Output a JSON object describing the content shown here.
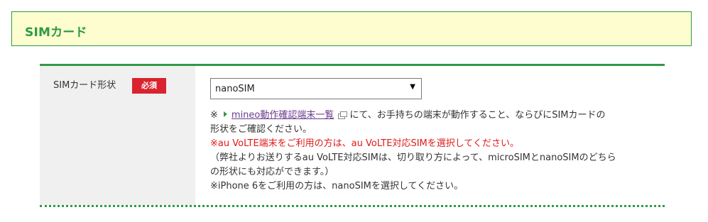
{
  "section": {
    "title": "SIMカード"
  },
  "field": {
    "label": "SIMカード形状",
    "required_badge": "必須",
    "selected_value": "nanoSIM",
    "dropdown_arrow": "▼"
  },
  "notes": {
    "prefix": "※",
    "link_text": "mineo動作確認端末一覧",
    "after_link_line1": "にて、お手持ちの端末が動作すること、ならびにSIMカードの",
    "line2": "形状をご確認ください。",
    "volte_red": "※au VoLTE端末をご利用の方は、au VoLTE対応SIMを選択してください。",
    "volte_line1": "（弊社よりお送りするau VoLTE対応SIMは、切り取り方によって、microSIMとnanoSIMのどちら",
    "volte_line2": "の形状にも対応ができます。）",
    "iphone": "※iPhone 6をご利用の方は、nanoSIMを選択してください。"
  },
  "icons": {
    "link_bullet": "triangle-right-icon",
    "external": "external-window-icon",
    "dropdown": "chevron-down-icon"
  },
  "colors": {
    "brand_green": "#2f9a44",
    "header_bg": "#fdfdcf",
    "required_red": "#d9232e",
    "notice_red": "#e01a1a",
    "label_bg": "#f0f0f0",
    "link_purple": "#6a3b8c"
  }
}
